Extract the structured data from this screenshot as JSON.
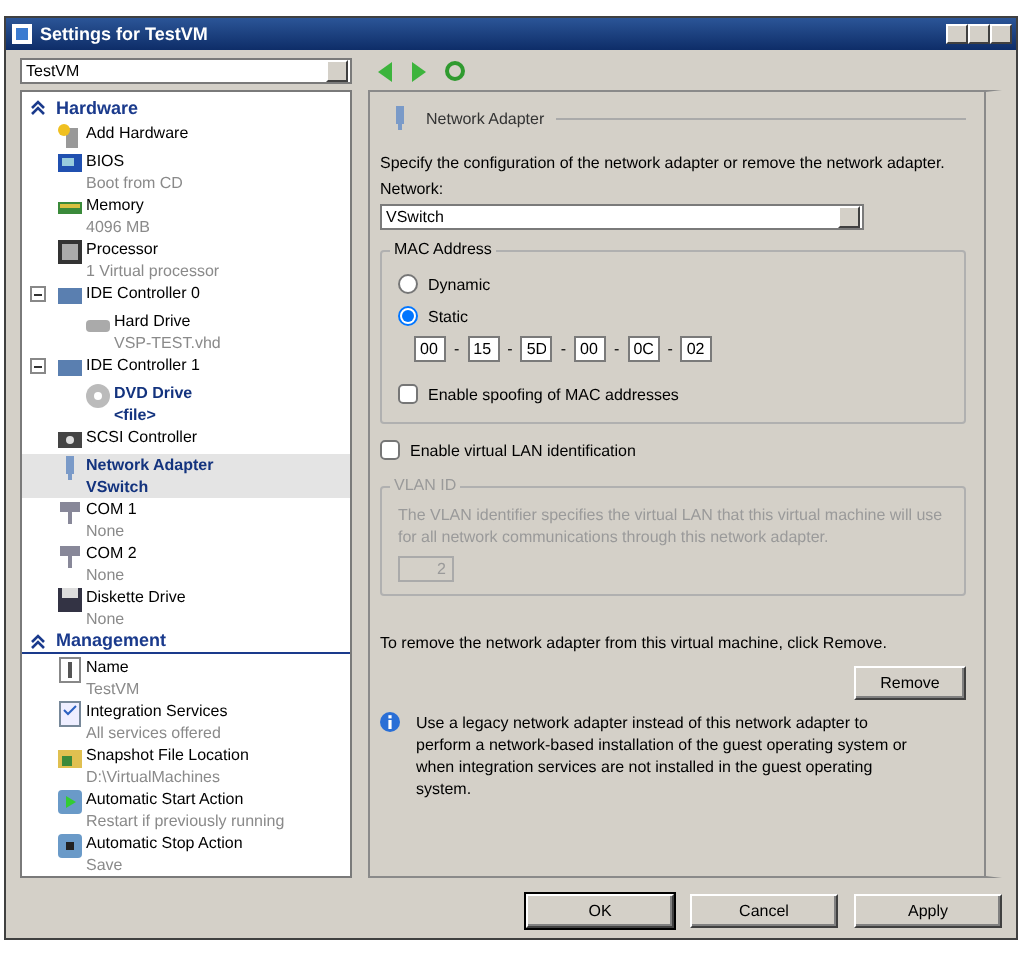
{
  "window": {
    "title": "Settings for TestVM"
  },
  "vm_selector": {
    "value": "TestVM"
  },
  "sidebar": {
    "sections": [
      {
        "label": "Hardware",
        "expanded": true,
        "items": [
          {
            "kind": "add",
            "label": "Add Hardware",
            "selected": false,
            "highlighted": false
          },
          {
            "kind": "bios",
            "label": "BIOS",
            "detail": "Boot from CD",
            "selected": false,
            "highlighted": false
          },
          {
            "kind": "memory",
            "label": "Memory",
            "detail": "4096 MB",
            "selected": false,
            "highlighted": false
          },
          {
            "kind": "processor",
            "label": "Processor",
            "detail": "1 Virtual processor",
            "selected": false,
            "highlighted": false
          },
          {
            "kind": "controller",
            "label": "IDE Controller 0",
            "selected": false,
            "highlighted": false,
            "expanded": true,
            "children": [
              {
                "kind": "disk",
                "label": "Hard Drive",
                "detail": "VSP-TEST.vhd",
                "selected": false,
                "highlighted": false
              }
            ]
          },
          {
            "kind": "controller",
            "label": "IDE Controller 1",
            "selected": false,
            "highlighted": false,
            "expanded": true,
            "children": [
              {
                "kind": "dvd",
                "label": "DVD Drive",
                "detail": "<file>",
                "selected": false,
                "highlighted": true
              }
            ]
          },
          {
            "kind": "scsi",
            "label": "SCSI Controller",
            "selected": false,
            "highlighted": false
          },
          {
            "kind": "network",
            "label": "Network Adapter",
            "detail": "VSwitch",
            "selected": true,
            "highlighted": true
          },
          {
            "kind": "port",
            "label": "COM 1",
            "detail": "None",
            "selected": false,
            "highlighted": false
          },
          {
            "kind": "port",
            "label": "COM 2",
            "detail": "None",
            "selected": false,
            "highlighted": false
          },
          {
            "kind": "floppy",
            "label": "Diskette Drive",
            "detail": "None",
            "selected": false,
            "highlighted": false
          }
        ]
      },
      {
        "label": "Management",
        "expanded": true,
        "items": [
          {
            "kind": "name",
            "label": "Name",
            "detail": "TestVM",
            "selected": false,
            "highlighted": false
          },
          {
            "kind": "integration",
            "label": "Integration Services",
            "detail": "All services offered",
            "selected": false,
            "highlighted": false
          },
          {
            "kind": "folder",
            "label": "Snapshot File Location",
            "detail": "D:\\VirtualMachines",
            "selected": false,
            "highlighted": false
          },
          {
            "kind": "start",
            "label": "Automatic Start Action",
            "detail": "Restart if previously running",
            "selected": false,
            "highlighted": false
          },
          {
            "kind": "stop",
            "label": "Automatic Stop Action",
            "detail": "Save",
            "selected": false,
            "highlighted": false
          }
        ]
      }
    ]
  },
  "panel": {
    "title": "Network Adapter",
    "description": "Specify the configuration of the network adapter or remove the network adapter.",
    "network_label": "Network:",
    "network_value": "VSwitch",
    "mac": {
      "title": "MAC Address",
      "options": [
        {
          "label": "Dynamic",
          "selected": false
        },
        {
          "label": "Static",
          "selected": true
        }
      ],
      "octets": [
        "00",
        "15",
        "5D",
        "00",
        "0C",
        "02"
      ],
      "separator": "-",
      "spoofing": {
        "label": "Enable spoofing of MAC addresses",
        "checked": false
      }
    },
    "vlan_enable": {
      "label": "Enable virtual LAN identification",
      "checked": false
    },
    "vlan": {
      "title": "VLAN ID",
      "disabled": true,
      "description": "The VLAN identifier specifies the virtual LAN that this virtual machine will use for all network communications through this network adapter.",
      "value": "2"
    },
    "remove_text": "To remove the network adapter from this virtual machine, click Remove.",
    "remove_button": "Remove",
    "info": "Use a legacy network adapter instead of this network adapter to perform a network-based installation of the guest operating system or when integration services are not installed in the guest operating system."
  },
  "buttons": [
    {
      "label": "OK",
      "default": true
    },
    {
      "label": "Cancel",
      "default": false
    },
    {
      "label": "Apply",
      "default": false
    }
  ]
}
